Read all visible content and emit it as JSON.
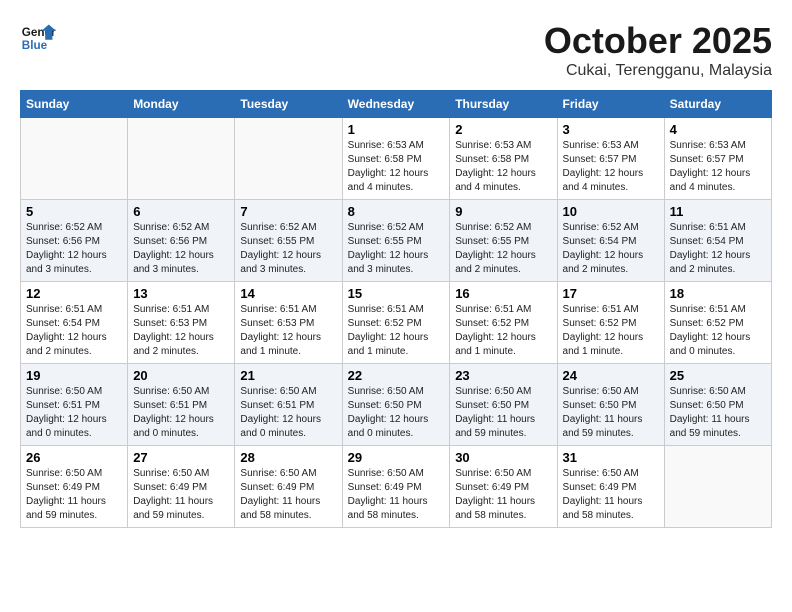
{
  "header": {
    "logo_general": "General",
    "logo_blue": "Blue",
    "month_title": "October 2025",
    "location": "Cukai, Terengganu, Malaysia"
  },
  "days_of_week": [
    "Sunday",
    "Monday",
    "Tuesday",
    "Wednesday",
    "Thursday",
    "Friday",
    "Saturday"
  ],
  "weeks": [
    [
      {
        "day": "",
        "info": ""
      },
      {
        "day": "",
        "info": ""
      },
      {
        "day": "",
        "info": ""
      },
      {
        "day": "1",
        "info": "Sunrise: 6:53 AM\nSunset: 6:58 PM\nDaylight: 12 hours\nand 4 minutes."
      },
      {
        "day": "2",
        "info": "Sunrise: 6:53 AM\nSunset: 6:58 PM\nDaylight: 12 hours\nand 4 minutes."
      },
      {
        "day": "3",
        "info": "Sunrise: 6:53 AM\nSunset: 6:57 PM\nDaylight: 12 hours\nand 4 minutes."
      },
      {
        "day": "4",
        "info": "Sunrise: 6:53 AM\nSunset: 6:57 PM\nDaylight: 12 hours\nand 4 minutes."
      }
    ],
    [
      {
        "day": "5",
        "info": "Sunrise: 6:52 AM\nSunset: 6:56 PM\nDaylight: 12 hours\nand 3 minutes."
      },
      {
        "day": "6",
        "info": "Sunrise: 6:52 AM\nSunset: 6:56 PM\nDaylight: 12 hours\nand 3 minutes."
      },
      {
        "day": "7",
        "info": "Sunrise: 6:52 AM\nSunset: 6:55 PM\nDaylight: 12 hours\nand 3 minutes."
      },
      {
        "day": "8",
        "info": "Sunrise: 6:52 AM\nSunset: 6:55 PM\nDaylight: 12 hours\nand 3 minutes."
      },
      {
        "day": "9",
        "info": "Sunrise: 6:52 AM\nSunset: 6:55 PM\nDaylight: 12 hours\nand 2 minutes."
      },
      {
        "day": "10",
        "info": "Sunrise: 6:52 AM\nSunset: 6:54 PM\nDaylight: 12 hours\nand 2 minutes."
      },
      {
        "day": "11",
        "info": "Sunrise: 6:51 AM\nSunset: 6:54 PM\nDaylight: 12 hours\nand 2 minutes."
      }
    ],
    [
      {
        "day": "12",
        "info": "Sunrise: 6:51 AM\nSunset: 6:54 PM\nDaylight: 12 hours\nand 2 minutes."
      },
      {
        "day": "13",
        "info": "Sunrise: 6:51 AM\nSunset: 6:53 PM\nDaylight: 12 hours\nand 2 minutes."
      },
      {
        "day": "14",
        "info": "Sunrise: 6:51 AM\nSunset: 6:53 PM\nDaylight: 12 hours\nand 1 minute."
      },
      {
        "day": "15",
        "info": "Sunrise: 6:51 AM\nSunset: 6:52 PM\nDaylight: 12 hours\nand 1 minute."
      },
      {
        "day": "16",
        "info": "Sunrise: 6:51 AM\nSunset: 6:52 PM\nDaylight: 12 hours\nand 1 minute."
      },
      {
        "day": "17",
        "info": "Sunrise: 6:51 AM\nSunset: 6:52 PM\nDaylight: 12 hours\nand 1 minute."
      },
      {
        "day": "18",
        "info": "Sunrise: 6:51 AM\nSunset: 6:52 PM\nDaylight: 12 hours\nand 0 minutes."
      }
    ],
    [
      {
        "day": "19",
        "info": "Sunrise: 6:50 AM\nSunset: 6:51 PM\nDaylight: 12 hours\nand 0 minutes."
      },
      {
        "day": "20",
        "info": "Sunrise: 6:50 AM\nSunset: 6:51 PM\nDaylight: 12 hours\nand 0 minutes."
      },
      {
        "day": "21",
        "info": "Sunrise: 6:50 AM\nSunset: 6:51 PM\nDaylight: 12 hours\nand 0 minutes."
      },
      {
        "day": "22",
        "info": "Sunrise: 6:50 AM\nSunset: 6:50 PM\nDaylight: 12 hours\nand 0 minutes."
      },
      {
        "day": "23",
        "info": "Sunrise: 6:50 AM\nSunset: 6:50 PM\nDaylight: 11 hours\nand 59 minutes."
      },
      {
        "day": "24",
        "info": "Sunrise: 6:50 AM\nSunset: 6:50 PM\nDaylight: 11 hours\nand 59 minutes."
      },
      {
        "day": "25",
        "info": "Sunrise: 6:50 AM\nSunset: 6:50 PM\nDaylight: 11 hours\nand 59 minutes."
      }
    ],
    [
      {
        "day": "26",
        "info": "Sunrise: 6:50 AM\nSunset: 6:49 PM\nDaylight: 11 hours\nand 59 minutes."
      },
      {
        "day": "27",
        "info": "Sunrise: 6:50 AM\nSunset: 6:49 PM\nDaylight: 11 hours\nand 59 minutes."
      },
      {
        "day": "28",
        "info": "Sunrise: 6:50 AM\nSunset: 6:49 PM\nDaylight: 11 hours\nand 58 minutes."
      },
      {
        "day": "29",
        "info": "Sunrise: 6:50 AM\nSunset: 6:49 PM\nDaylight: 11 hours\nand 58 minutes."
      },
      {
        "day": "30",
        "info": "Sunrise: 6:50 AM\nSunset: 6:49 PM\nDaylight: 11 hours\nand 58 minutes."
      },
      {
        "day": "31",
        "info": "Sunrise: 6:50 AM\nSunset: 6:49 PM\nDaylight: 11 hours\nand 58 minutes."
      },
      {
        "day": "",
        "info": ""
      }
    ]
  ]
}
